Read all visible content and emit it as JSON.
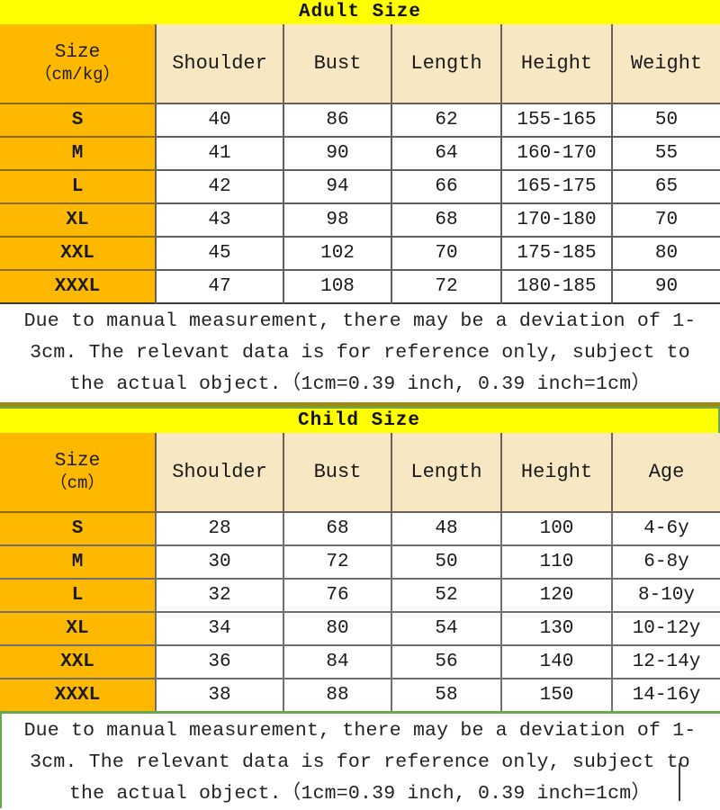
{
  "adult": {
    "title": "Adult Size",
    "size_header": {
      "label": "Size",
      "unit": "（cm/kg）"
    },
    "columns": [
      "Shoulder",
      "Bust",
      "Length",
      "Height",
      "Weight"
    ],
    "rows": [
      {
        "size": "S",
        "shoulder": "40",
        "bust": "86",
        "length": "62",
        "height": "155-165",
        "weight": "50"
      },
      {
        "size": "M",
        "shoulder": "41",
        "bust": "90",
        "length": "64",
        "height": "160-170",
        "weight": "55"
      },
      {
        "size": "L",
        "shoulder": "42",
        "bust": "94",
        "length": "66",
        "height": "165-175",
        "weight": "65"
      },
      {
        "size": "XL",
        "shoulder": "43",
        "bust": "98",
        "length": "68",
        "height": "170-180",
        "weight": "70"
      },
      {
        "size": "XXL",
        "shoulder": "45",
        "bust": "102",
        "length": "70",
        "height": "175-185",
        "weight": "80"
      },
      {
        "size": "XXXL",
        "shoulder": "47",
        "bust": "108",
        "length": "72",
        "height": "180-185",
        "weight": "90"
      }
    ],
    "note_lines": [
      "Due to manual measurement, there may be a deviation of 1-",
      "3cm. The relevant data is for reference only, subject to",
      "the actual object.（1cm=0.39 inch, 0.39 inch=1cm）"
    ]
  },
  "child": {
    "title": "Child Size",
    "size_header": {
      "label": "Size",
      "unit": "（cm）"
    },
    "columns": [
      "Shoulder",
      "Bust",
      "Length",
      "Height",
      "Age"
    ],
    "rows": [
      {
        "size": "S",
        "shoulder": "28",
        "bust": "68",
        "length": "48",
        "height": "100",
        "age": "4-6y"
      },
      {
        "size": "M",
        "shoulder": "30",
        "bust": "72",
        "length": "50",
        "height": "110",
        "age": "6-8y"
      },
      {
        "size": "L",
        "shoulder": "32",
        "bust": "76",
        "length": "52",
        "height": "120",
        "age": "8-10y"
      },
      {
        "size": "XL",
        "shoulder": "34",
        "bust": "80",
        "length": "54",
        "height": "130",
        "age": "10-12y"
      },
      {
        "size": "XXL",
        "shoulder": "36",
        "bust": "84",
        "length": "56",
        "height": "140",
        "age": "12-14y"
      },
      {
        "size": "XXXL",
        "shoulder": "38",
        "bust": "88",
        "length": "58",
        "height": "150",
        "age": "14-16y"
      }
    ],
    "note_lines": [
      "Due to manual measurement, there may be a deviation of 1-",
      "3cm. The relevant data is for reference only, subject to",
      "the actual object.（1cm=0.39 inch, 0.39 inch=1cm）"
    ]
  },
  "colors": {
    "title_bar": "#FFFF00",
    "size_column": "#FFB800",
    "header_cell": "#F7E7C3",
    "data_cell": "#FFFFFF",
    "child_table_border": "#6AA84F",
    "note_divider": "#9C8B12",
    "text": "#1A1A1A"
  }
}
